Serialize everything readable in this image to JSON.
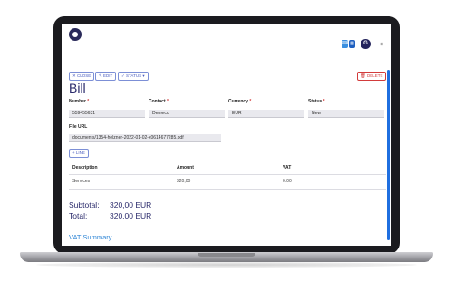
{
  "header": {
    "avatar_initial": "G",
    "logout_glyph": "⇥"
  },
  "toolbar": {
    "close_label": "✕ CLOSE",
    "edit_label": "✎ EDIT",
    "status_label": "✓ STATUS ▾",
    "delete_label": "🗑 DELETE"
  },
  "page": {
    "title": "Bill"
  },
  "form": {
    "number_label": "Number",
    "number_value": "559455631",
    "contact_label": "Contact",
    "contact_value": "Demeco",
    "currency_label": "Currency",
    "currency_value": "EUR",
    "status_label": "Status",
    "status_value": "New",
    "required_mark": "*",
    "file_url_label": "File URL",
    "file_url_value": "documents/1354-helzner-2022-01-02-x0614677285.pdf"
  },
  "lines": {
    "add_line_label": "+ LINE",
    "columns": [
      "Description",
      "Amount",
      "VAT"
    ],
    "rows": [
      {
        "description": "Services",
        "amount": "320,00",
        "vat": "0.00"
      }
    ]
  },
  "totals": {
    "subtotal_label": "Subtotal:",
    "subtotal_value": "320,00 EUR",
    "total_label": "Total:",
    "total_value": "320,00 EUR"
  },
  "vat_summary": {
    "title": "VAT Summary"
  },
  "colors": {
    "primary": "#2a2a6b",
    "accent": "#2f86d6",
    "danger": "#d23b3b"
  }
}
